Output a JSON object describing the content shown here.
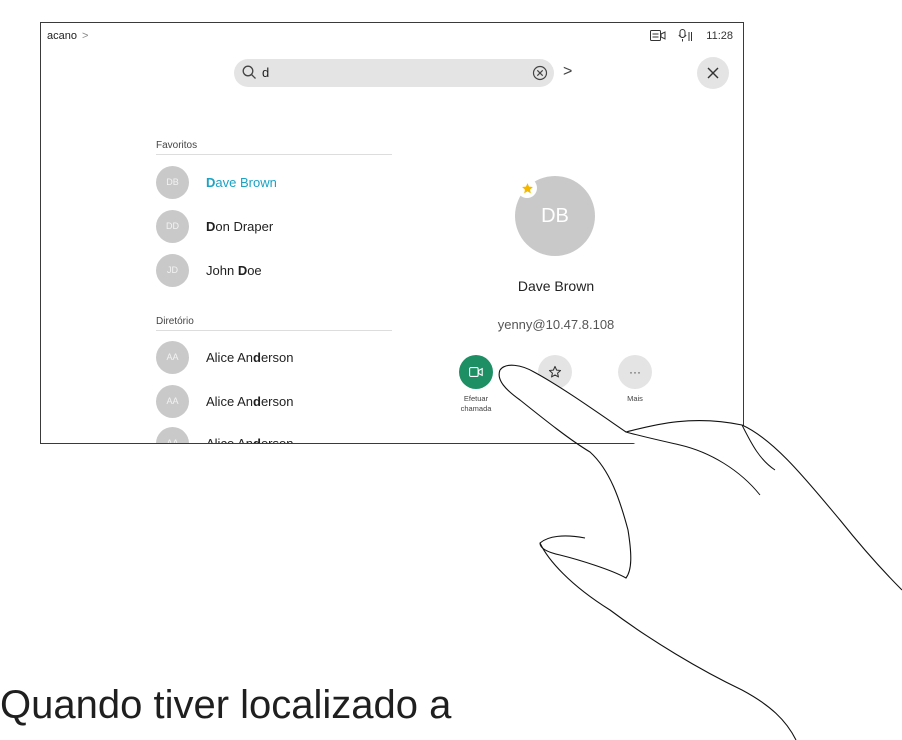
{
  "topbar": {
    "breadcrumb": "acano",
    "breadcrumb_chevron": ">",
    "time": "11:28"
  },
  "search": {
    "query": "d",
    "go_chevron": ">"
  },
  "sections": {
    "favorites_label": "Favoritos",
    "directory_label": "Diretório"
  },
  "favorites": [
    {
      "initials": "DB",
      "pre": "",
      "hl": "D",
      "post": "ave Brown",
      "selected": true
    },
    {
      "initials": "DD",
      "pre": "",
      "hl": "D",
      "post": "on Draper",
      "selected": false
    },
    {
      "initials": "JD",
      "pre": "John ",
      "hl": "D",
      "post": "oe",
      "selected": false
    }
  ],
  "directory": [
    {
      "initials": "AA",
      "pre": "Alice An",
      "hl": "d",
      "post": "erson"
    },
    {
      "initials": "AA",
      "pre": "Alice An",
      "hl": "d",
      "post": "erson"
    },
    {
      "initials": "AA",
      "pre": "Alice An",
      "hl": "d",
      "post": "erson"
    }
  ],
  "contact": {
    "initials": "DB",
    "name": "Dave Brown",
    "address": "yenny@10.47.8.108"
  },
  "actions": {
    "call_label_line1": "Efetuar",
    "call_label_line2": "chamada",
    "more_label": "Mais",
    "more_glyph": "···"
  },
  "caption": "Quando tiver localizado a",
  "colors": {
    "accent_selected": "#19a3c4",
    "call_button": "#1e8f64",
    "favorite_star": "#f5b800"
  }
}
